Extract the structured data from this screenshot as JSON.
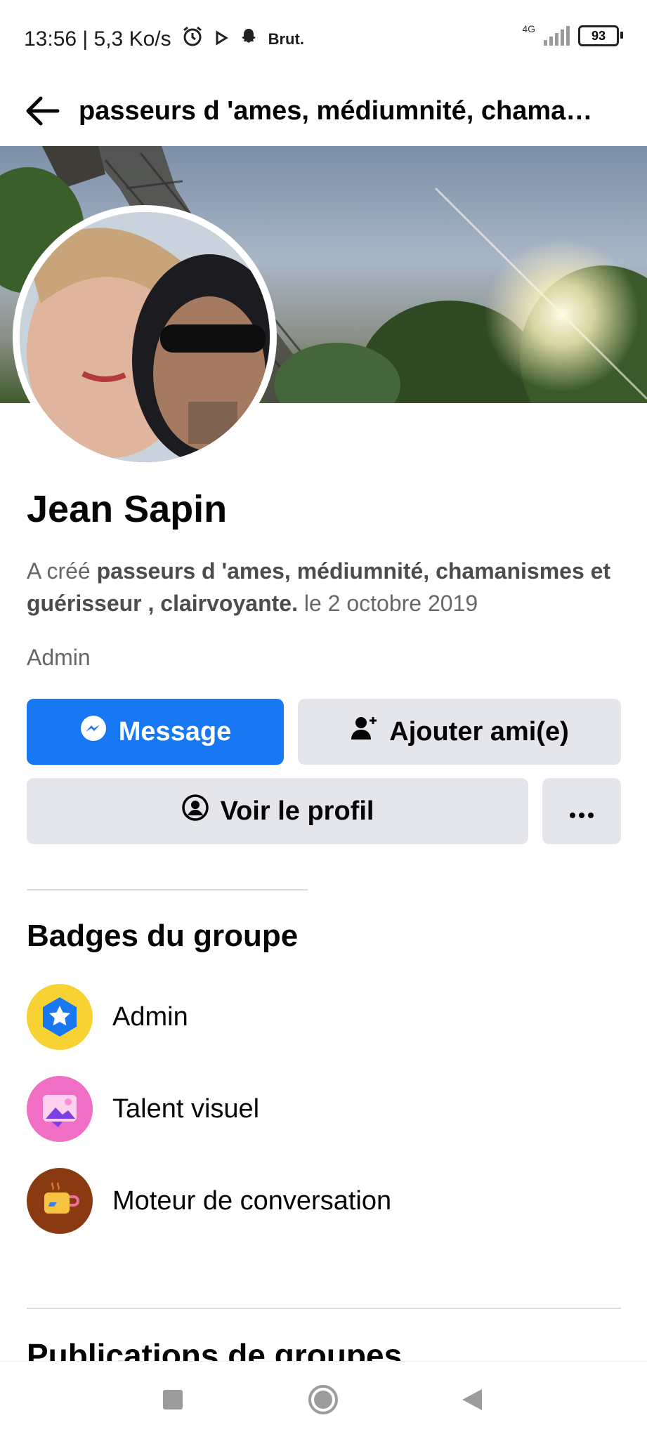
{
  "status_bar": {
    "time_speed": "13:56 | 5,3 Ko/s",
    "notification_label": "Brut.",
    "network": "4G",
    "battery": "93"
  },
  "app_bar": {
    "title": "passeurs d 'ames, médiumnité, chama…"
  },
  "profile": {
    "name": "Jean Sapin",
    "created_prefix": "A créé",
    "group_name": "passeurs d 'ames, médiumnité, chamanismes et guérisseur , clairvoyante.",
    "created_date": "le 2 octobre 2019",
    "role": "Admin"
  },
  "actions": {
    "message": "Message",
    "add_friend": "Ajouter ami(e)",
    "view_profile": "Voir le profil"
  },
  "badges": {
    "title": "Badges du groupe",
    "items": [
      {
        "label": "Admin",
        "icon": "admin-star-icon",
        "color": "#f7d232"
      },
      {
        "label": "Talent visuel",
        "icon": "visual-talent-icon",
        "color": "#f06fc4"
      },
      {
        "label": "Moteur de conversation",
        "icon": "coffee-cup-icon",
        "color": "#8a3a10"
      }
    ]
  },
  "posts_section": {
    "title": "Publications de groupes"
  },
  "colors": {
    "primary": "#1877f2",
    "secondary_button": "#e4e6eb",
    "muted_text": "#65676b"
  }
}
